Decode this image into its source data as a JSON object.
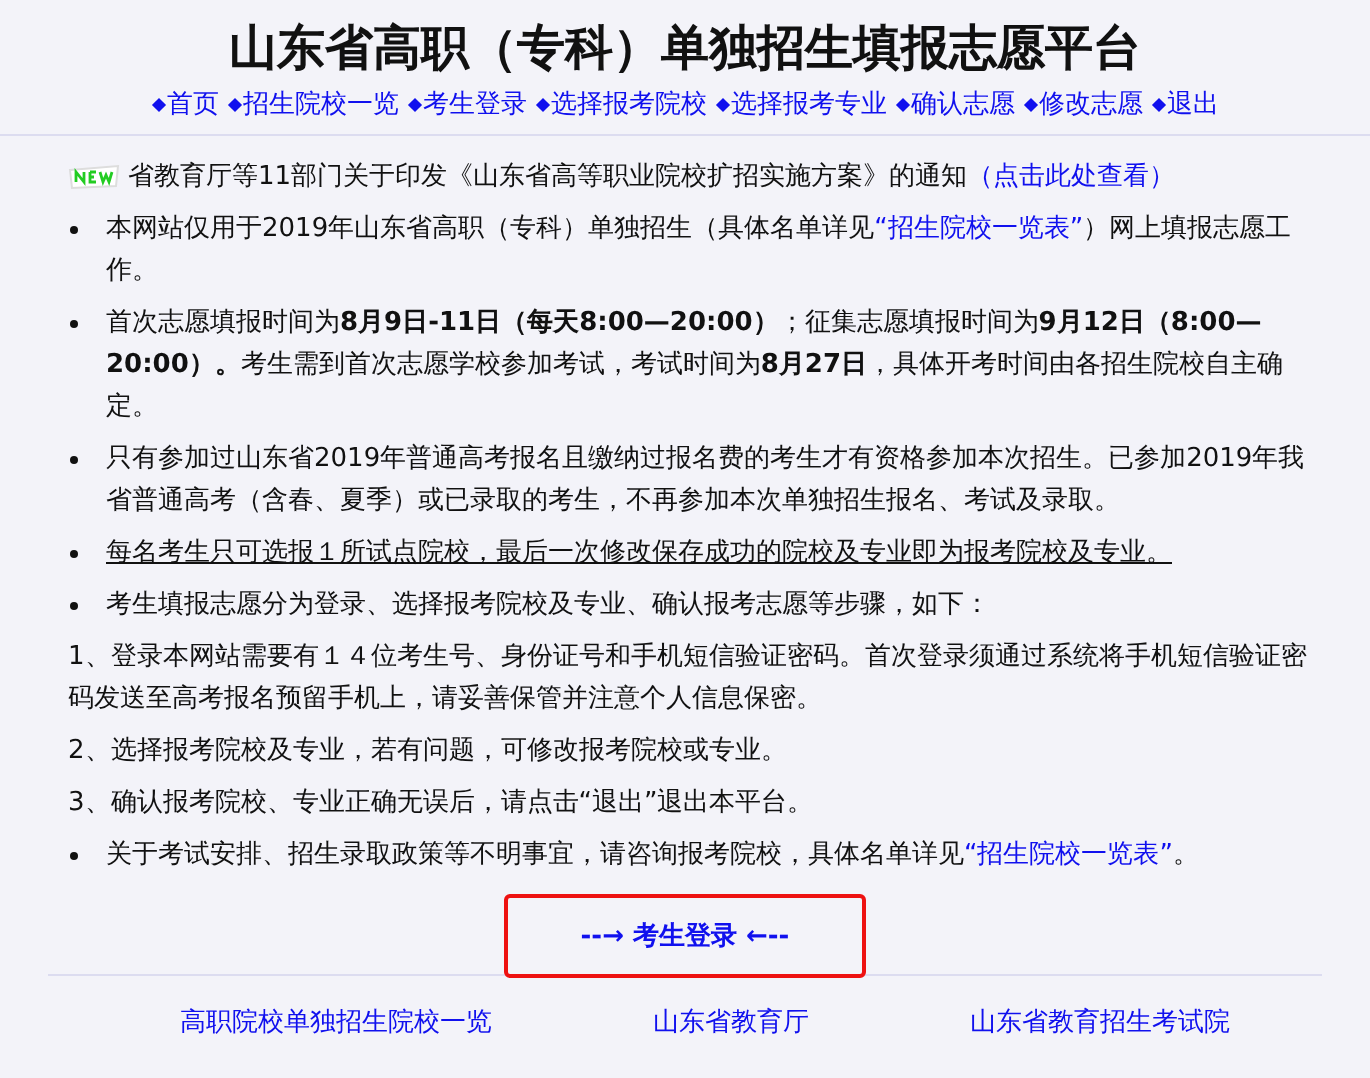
{
  "title": "山东省高职（专科）单独招生填报志愿平台",
  "nav": [
    {
      "label": "首页"
    },
    {
      "label": "招生院校一览"
    },
    {
      "label": "考生登录"
    },
    {
      "label": "选择报考院校"
    },
    {
      "label": "选择报考专业"
    },
    {
      "label": "确认志愿"
    },
    {
      "label": "修改志愿"
    },
    {
      "label": "退出"
    }
  ],
  "notice": {
    "segments": [
      {
        "kind": "text",
        "text": "省教育厅等11部门关于印发《山东省高等职业院校扩招实施方案》的通知"
      },
      {
        "kind": "link",
        "text": "（点击此处查看）"
      }
    ]
  },
  "items": [
    {
      "kind": "bullet",
      "underlined": false,
      "segments": [
        {
          "kind": "text",
          "text": "本网站仅用于2019年山东省高职（专科）单独招生（具体名单详见"
        },
        {
          "kind": "link",
          "text": "“招生院校一览表”"
        },
        {
          "kind": "text",
          "text": "）网上填报志愿工作。"
        }
      ]
    },
    {
      "kind": "bullet",
      "underlined": false,
      "segments": [
        {
          "kind": "text",
          "text": "首次志愿填报时间为**8月9日-11日（每天8:00—20:00）**；征集志愿填报时间为**9月12日（8:00—20:00）。**考生需到首次志愿学校参加考试，考试时间为**8月27日**，具体开考时间由各招生院校自主确定。"
        }
      ]
    },
    {
      "kind": "bullet",
      "underlined": false,
      "segments": [
        {
          "kind": "text",
          "text": "只有参加过山东省2019年普通高考报名且缴纳过报名费的考生才有资格参加本次招生。已参加2019年我省普通高考（含春、夏季）或已录取的考生，不再参加本次单独招生报名、考试及录取。"
        }
      ]
    },
    {
      "kind": "bullet",
      "underlined": true,
      "segments": [
        {
          "kind": "text",
          "text": "每名考生只可选报１所试点院校，最后一次修改保存成功的院校及专业即为报考院校及专业。"
        }
      ]
    },
    {
      "kind": "bullet",
      "underlined": false,
      "segments": [
        {
          "kind": "text",
          "text": "考生填报志愿分为登录、选择报考院校及专业、确认报考志愿等步骤，如下："
        }
      ]
    },
    {
      "kind": "plain",
      "underlined": false,
      "segments": [
        {
          "kind": "text",
          "text": "1、登录本网站需要有１４位考生号、身份证号和手机短信验证密码。首次登录须通过系统将手机短信验证密码发送至高考报名预留手机上，请妥善保管并注意个人信息保密。"
        }
      ]
    },
    {
      "kind": "plain",
      "underlined": false,
      "segments": [
        {
          "kind": "text",
          "text": "2、选择报考院校及专业，若有问题，可修改报考院校或专业。"
        }
      ]
    },
    {
      "kind": "plain",
      "underlined": false,
      "segments": [
        {
          "kind": "text",
          "text": "3、确认报考院校、专业正确无误后，请点击“退出”退出本平台。"
        }
      ]
    },
    {
      "kind": "bullet",
      "underlined": false,
      "segments": [
        {
          "kind": "text",
          "text": "关于考试安排、招生录取政策等不明事宜，请咨询报考院校，具体名单详见"
        },
        {
          "kind": "link",
          "text": "“招生院校一览表”"
        },
        {
          "kind": "text",
          "text": "。"
        }
      ]
    }
  ],
  "login": {
    "label": "--→ 考生登录 ←--",
    "highlighted": true
  },
  "footer_links": [
    {
      "label": "高职院校单独招生院校一览"
    },
    {
      "label": "山东省教育厅"
    },
    {
      "label": "山东省教育招生考试院"
    }
  ]
}
